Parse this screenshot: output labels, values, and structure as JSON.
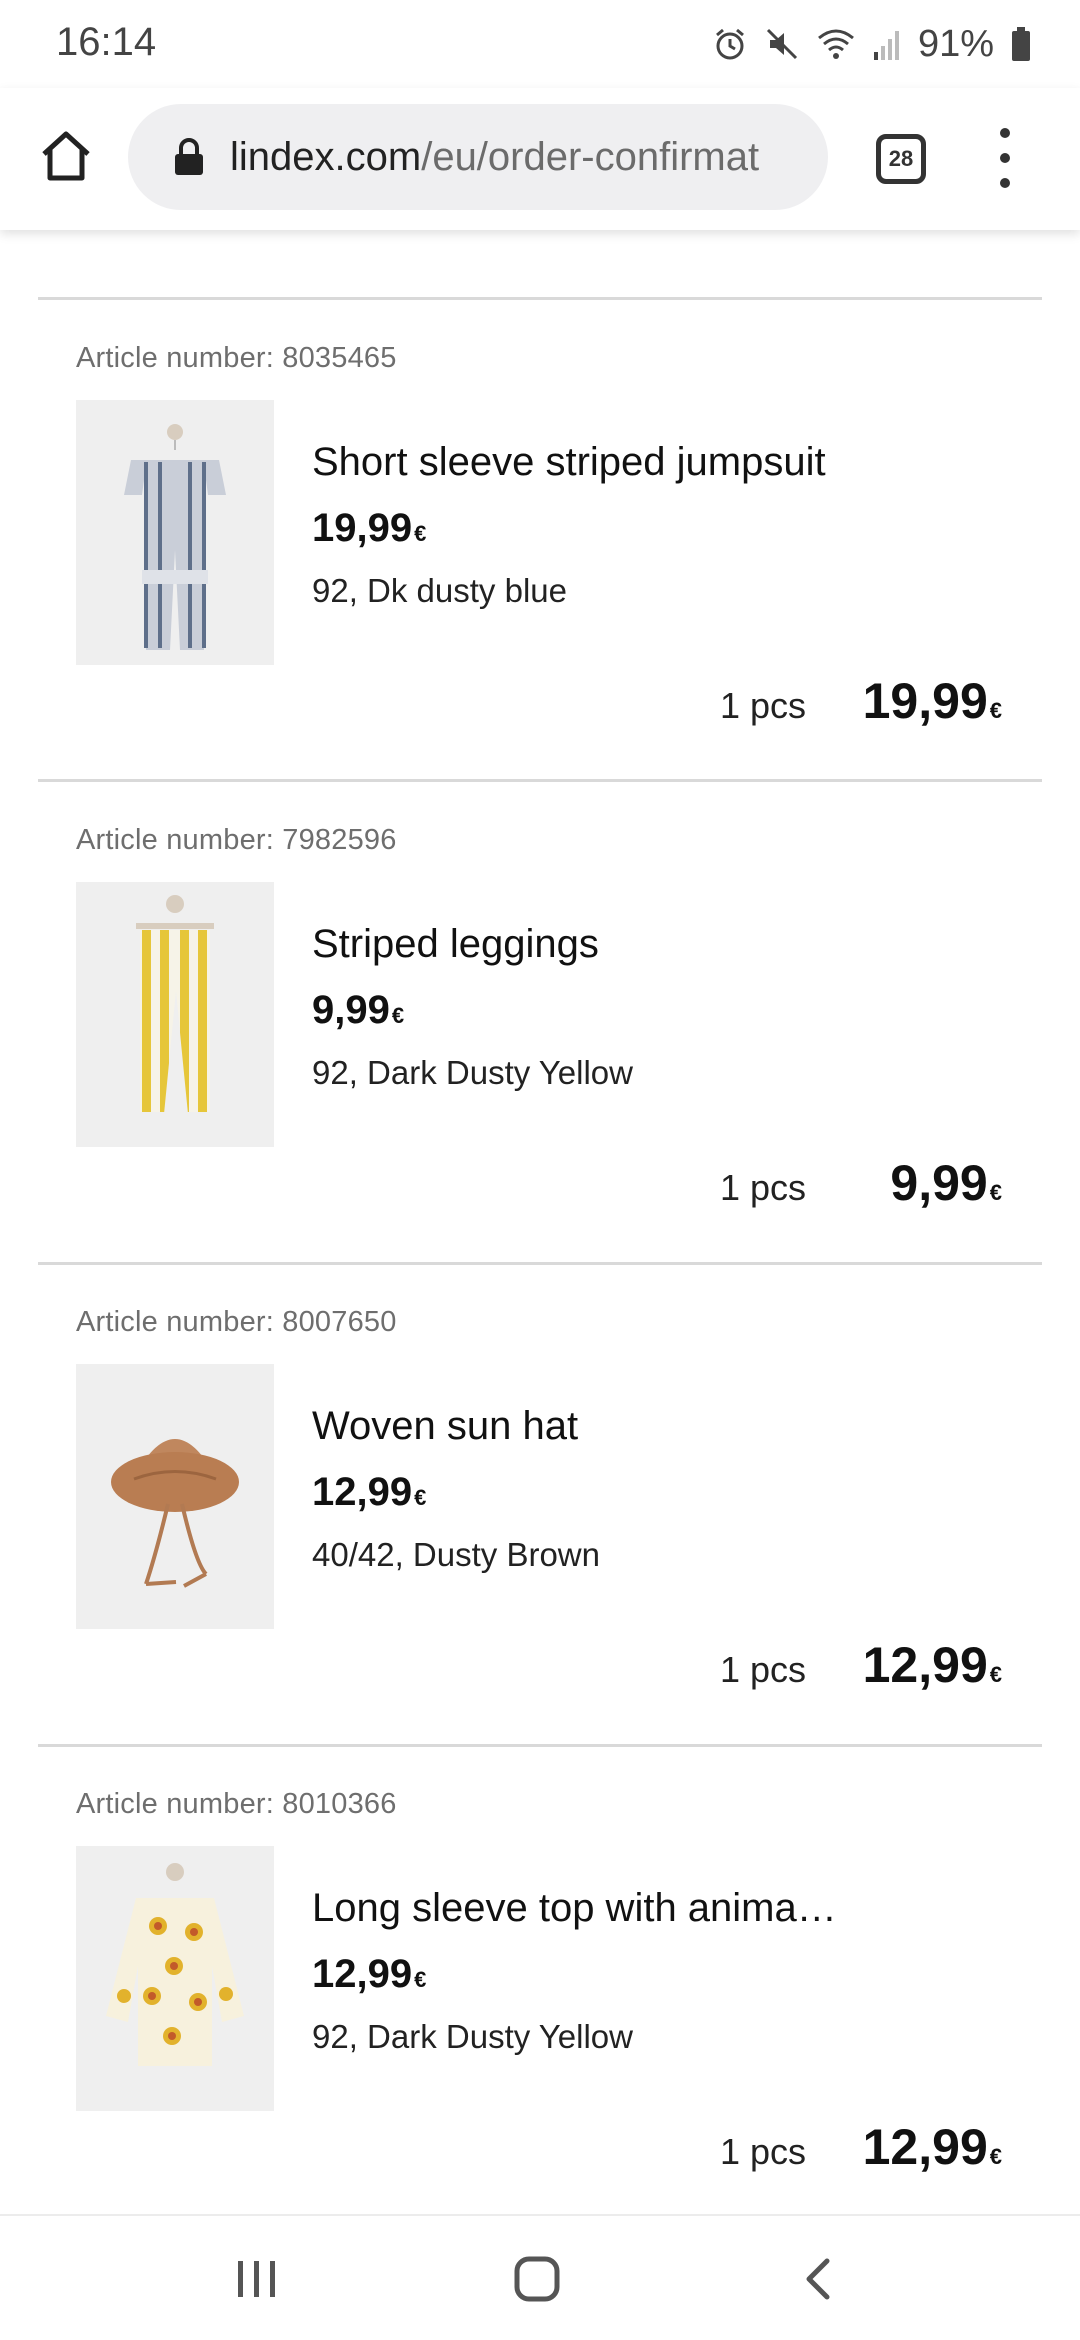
{
  "status": {
    "time": "16:14",
    "battery": "91%"
  },
  "browser": {
    "url_domain": "lindex.com",
    "url_path": "/eu/order-confirmat",
    "tab_count": "28"
  },
  "items": [
    {
      "article": "Article number: 8035465",
      "name": "Short sleeve striped jumpsuit",
      "price": "19,99",
      "currency": "€",
      "variant": "92, Dk dusty blue",
      "qty": "1 pcs",
      "total": "19,99"
    },
    {
      "article": "Article number: 7982596",
      "name": "Striped leggings",
      "price": "9,99",
      "currency": "€",
      "variant": "92, Dark Dusty Yellow",
      "qty": "1 pcs",
      "total": "9,99"
    },
    {
      "article": "Article number: 8007650",
      "name": "Woven sun hat",
      "price": "12,99",
      "currency": "€",
      "variant": "40/42, Dusty Brown",
      "qty": "1 pcs",
      "total": "12,99"
    },
    {
      "article": "Article number: 8010366",
      "name": "Long sleeve top with anima…",
      "price": "12,99",
      "currency": "€",
      "variant": "92, Dark Dusty Yellow",
      "qty": "1 pcs",
      "total": "12,99"
    }
  ],
  "icons": {
    "status": [
      "alarm-icon",
      "mute-icon",
      "wifi-icon",
      "signal-icon",
      "battery-icon"
    ],
    "browser": [
      "home-icon",
      "lock-icon",
      "tabs-icon",
      "more-vert-icon"
    ],
    "nav": [
      "recents-icon",
      "home-nav-icon",
      "back-icon"
    ]
  }
}
